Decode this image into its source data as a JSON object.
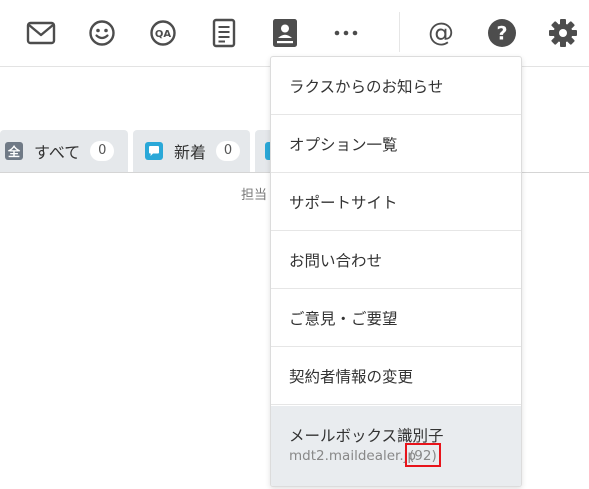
{
  "toolbar": {
    "icons": [
      {
        "name": "mail-icon"
      },
      {
        "name": "smiley-icon"
      },
      {
        "name": "qa-icon",
        "text": "QA"
      },
      {
        "name": "document-icon"
      },
      {
        "name": "contact-icon"
      },
      {
        "name": "more-icon",
        "text": "···"
      },
      {
        "name": "at-icon",
        "text": "@"
      },
      {
        "name": "help-icon",
        "text": "?"
      },
      {
        "name": "gear-icon"
      }
    ],
    "icon_color": "#4d4d4d"
  },
  "tabs": [
    {
      "icon": "全",
      "label": "すべて",
      "count": "0"
    },
    {
      "icon": "chat-icon",
      "label": "新着",
      "count": "0"
    },
    {
      "icon": "chat-icon"
    }
  ],
  "subtext": "担当",
  "menu": {
    "items": [
      "ラクスからのお知らせ",
      "オプション一覧",
      "サポートサイト",
      "お問い合わせ",
      "ご意見・ご要望",
      "契約者情報の変更"
    ],
    "mailbox": {
      "label": "メールボックス識別子",
      "host": "mdt2.maildealer.jp",
      "count": "(92)"
    },
    "highlight_color": "#e8141b"
  }
}
